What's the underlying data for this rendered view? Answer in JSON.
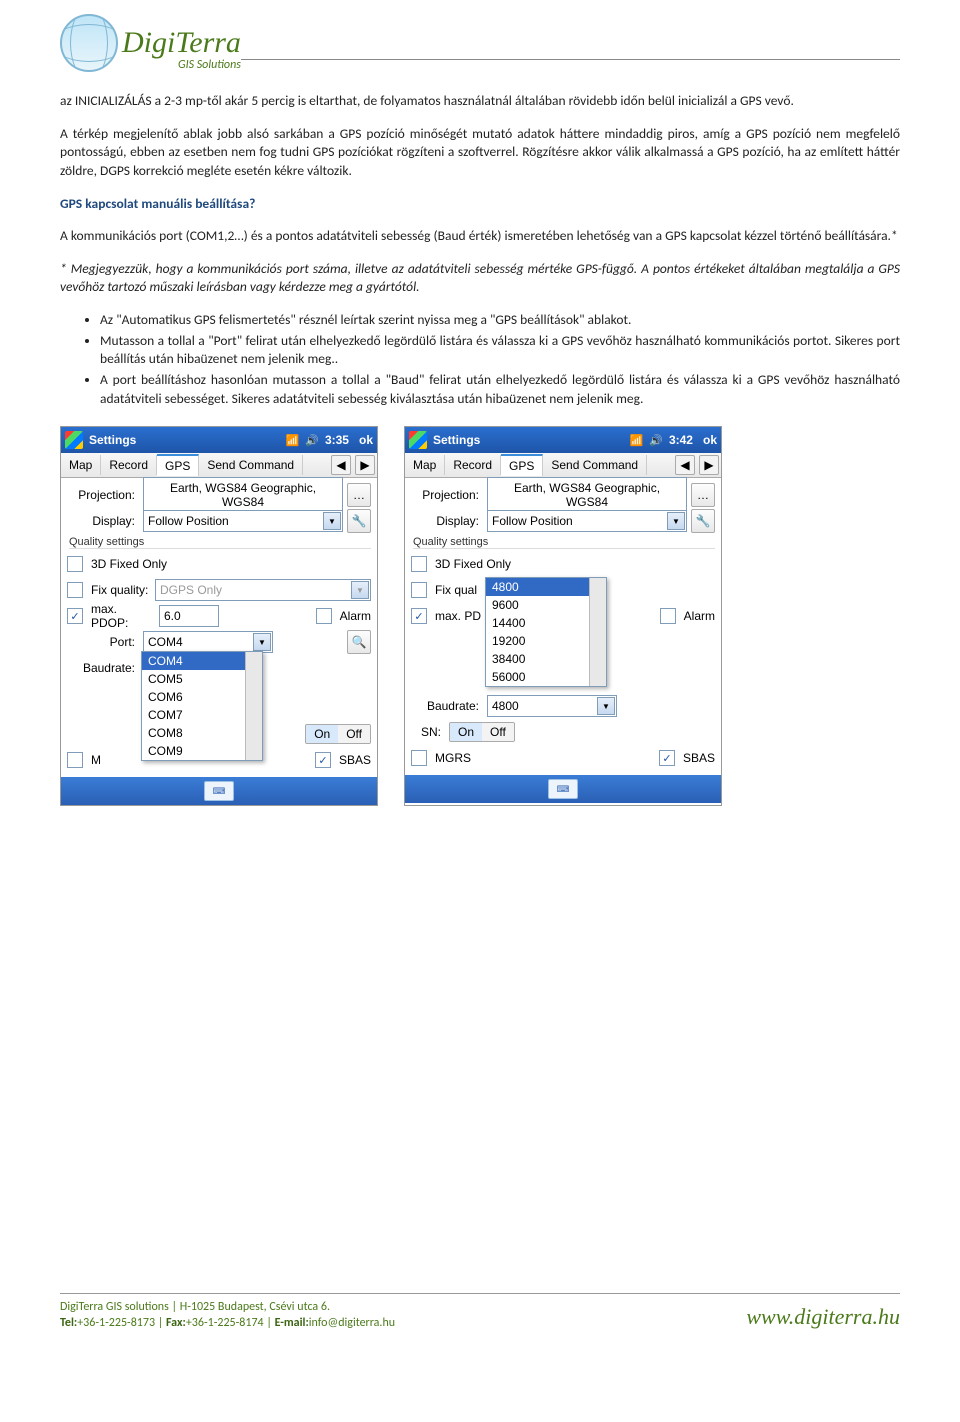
{
  "logo": {
    "brand": "DigiTerra",
    "sub": "GIS Solutions"
  },
  "paragraphs": {
    "p1": "az INICIALIZÁLÁS a 2-3 mp-től akár 5 percig is eltarthat, de folyamatos használatnál általában rövidebb időn belül inicializál a GPS vevő.",
    "p2": "A térkép megjelenítő ablak jobb alsó sarkában a GPS pozíció minőségét mutató adatok háttere mindaddig piros, amíg a GPS pozíció nem megfelelő pontosságú, ebben az esetben nem fog tudni GPS pozíciókat rögzíteni a szoftverrel. Rögzítésre akkor válik alkalmassá a GPS pozíció, ha az említett háttér zöldre, DGPS korrekció megléte esetén kékre változik.",
    "h1": "GPS kapcsolat manuális beállítása?",
    "p3": "A kommunikációs port (COM1,2…) és a pontos adatátviteli sebesség (Baud érték) ismeretében lehetőség van a GPS kapcsolat kézzel történő beállítására.*",
    "p4": "* Megjegyezzük, hogy a kommunikációs port száma, illetve az adatátviteli sebesség mértéke GPS-függő. A pontos értékeket általában megtalálja a GPS vevőhöz tartozó műszaki leírásban vagy kérdezze meg a gyártótól."
  },
  "bullets": [
    "Az \"Automatikus GPS felismertetés\" résznél leírtak szerint nyissa meg a \"GPS beállítások\" ablakot.",
    "Mutasson a tollal a \"Port\" felirat után elhelyezkedő legördülő listára és válassza ki a GPS vevőhöz használható kommunikációs portot. Sikeres port beállítás után hibaüzenet nem jelenik meg..",
    "A port beállításhoz hasonlóan mutasson a tollal a \"Baud\" felirat után elhelyezkedő legördülő listára és válassza ki a GPS vevőhöz használható adatátviteli sebességet. Sikeres adatátviteli sebesség kiválasztása után hibaüzenet nem jelenik meg."
  ],
  "screen_common": {
    "title": "Settings",
    "ok": "ok",
    "tabs": [
      "Map",
      "Record",
      "GPS",
      "Send Command"
    ],
    "projection_label": "Projection:",
    "projection_value": "Earth, WGS84 Geographic, WGS84",
    "display_label": "Display:",
    "display_value": "Follow Position",
    "quality_heading": "Quality settings",
    "fixed_label": "3D Fixed Only",
    "fixq_label": "Fix quality:",
    "fixq_value": "DGPS Only",
    "pdop_label": "max. PDOP:",
    "pdop_value": "6.0",
    "alarm_label": "Alarm",
    "port_label": "Port:",
    "baud_label": "Baudrate:",
    "sn_label": "SN:",
    "on": "On",
    "off": "Off",
    "mgrs": "MGRS",
    "sbas": "SBAS"
  },
  "screen1": {
    "time": "3:35",
    "port_value": "COM4",
    "port_options": [
      "COM4",
      "COM5",
      "COM6",
      "COM7",
      "COM8",
      "COM9"
    ],
    "mgrs_checked": false,
    "sn_on": true
  },
  "screen2": {
    "time": "3:42",
    "pdop_label_short": "max. PD",
    "fixq_short": "Fix qual",
    "baud_value": "4800",
    "baud_sel": "4800",
    "baud_options": [
      "4800",
      "9600",
      "14400",
      "19200",
      "38400",
      "56000"
    ],
    "mgrs_checked": false,
    "sn_on": true
  },
  "footer": {
    "line1": "DigiTerra GIS solutions   |   H-1025 Budapest, Csévi utca 6.",
    "line2_a": "Tel:",
    "line2_b": "+36-1-225-8173 | ",
    "line2_c": "Fax:",
    "line2_d": "+36-1-225-8174 | ",
    "line2_e": "E-mail:",
    "line2_f": "info@digiterra.hu",
    "site": "www.digiterra.hu"
  }
}
